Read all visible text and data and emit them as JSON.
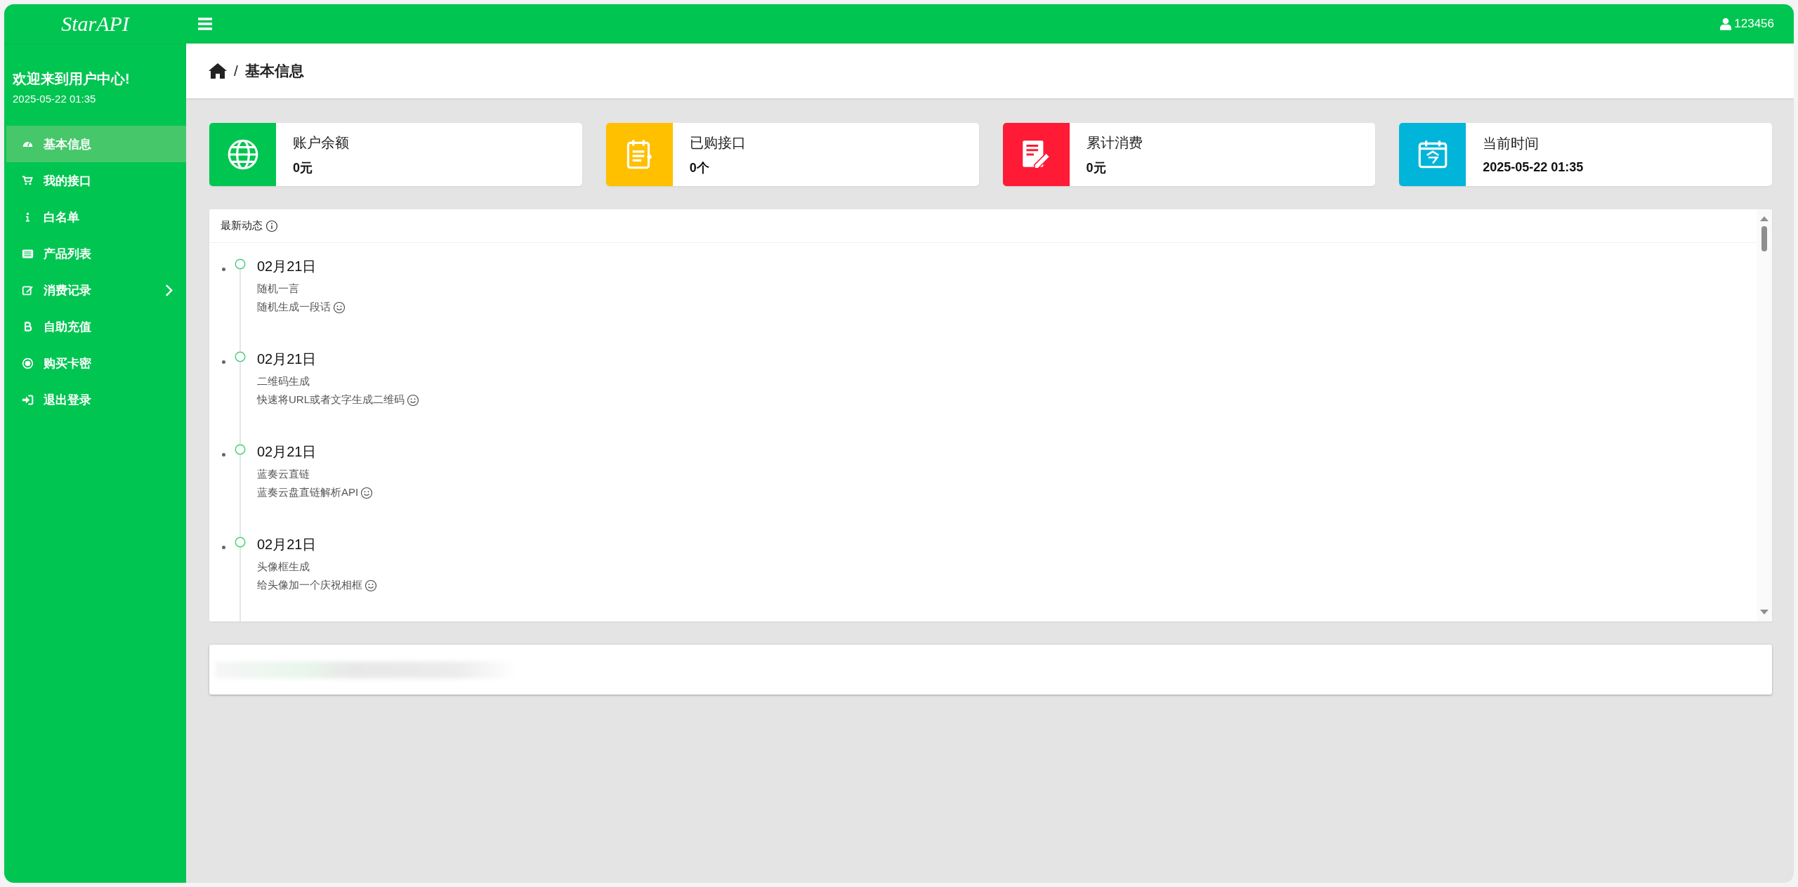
{
  "brand": "StarAPI",
  "topbar": {
    "user": "123456"
  },
  "sidebar": {
    "welcome": "欢迎来到用户中心!",
    "datetime": "2025-05-22 01:35",
    "items": [
      {
        "label": "基本信息",
        "selected": true,
        "expandable": false
      },
      {
        "label": "我的接口",
        "selected": false,
        "expandable": false
      },
      {
        "label": "白名单",
        "selected": false,
        "expandable": false
      },
      {
        "label": "产品列表",
        "selected": false,
        "expandable": false
      },
      {
        "label": "消费记录",
        "selected": false,
        "expandable": true
      },
      {
        "label": "自助充值",
        "selected": false,
        "expandable": false
      },
      {
        "label": "购买卡密",
        "selected": false,
        "expandable": false
      },
      {
        "label": "退出登录",
        "selected": false,
        "expandable": false
      }
    ]
  },
  "breadcrumb": {
    "separator": "/",
    "current": "基本信息"
  },
  "stats": [
    {
      "label": "账户余额",
      "value": "0元",
      "color": "#00c551"
    },
    {
      "label": "已购接口",
      "value": "0个",
      "color": "#ffc000"
    },
    {
      "label": "累计消费",
      "value": "0元",
      "color": "#ff1a35"
    },
    {
      "label": "当前时间",
      "value": "2025-05-22 01:35",
      "color": "#00b5d9"
    }
  ],
  "feed": {
    "title": "最新动态",
    "items": [
      {
        "date": "02月21日",
        "title": "随机一言",
        "description": "随机生成一段话"
      },
      {
        "date": "02月21日",
        "title": "二维码生成",
        "description": "快速将URL或者文字生成二维码"
      },
      {
        "date": "02月21日",
        "title": "蓝奏云直链",
        "description": "蓝奏云盘直链解析API"
      },
      {
        "date": "02月21日",
        "title": "头像框生成",
        "description": "给头像加一个庆祝相框"
      }
    ]
  }
}
